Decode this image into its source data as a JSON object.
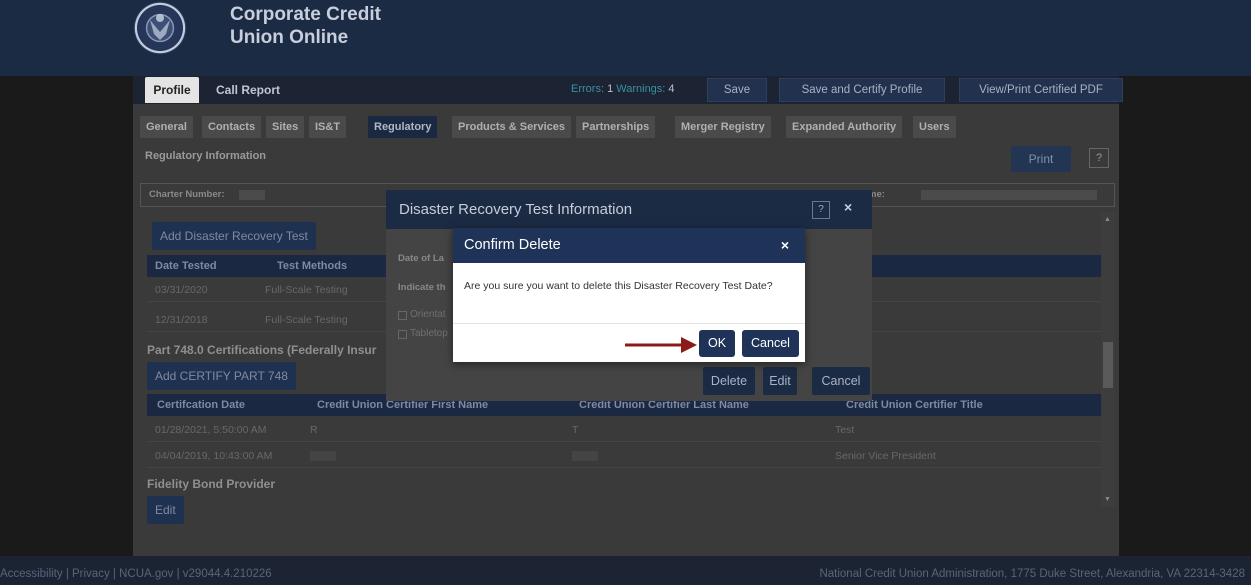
{
  "app": {
    "title": "Corporate Credit Union Online"
  },
  "top_tabs": {
    "profile": "Profile",
    "call_report": "Call Report"
  },
  "status": {
    "errors_label": "Errors:",
    "errors_count": "1",
    "warnings_label": "Warnings:",
    "warnings_count": "4"
  },
  "header_buttons": {
    "save": "Save",
    "save_certify": "Save and Certify Profile",
    "view_print": "View/Print Certified PDF"
  },
  "sub_tabs": [
    "General",
    "Contacts",
    "Sites",
    "IS&T",
    "Regulatory",
    "Products & Services",
    "Partnerships",
    "Merger Registry",
    "Expanded Authority",
    "Users"
  ],
  "active_sub_tab": "Regulatory",
  "section": {
    "title": "Regulatory Information",
    "print": "Print",
    "help": "?"
  },
  "charter_bar": {
    "charter_label": "Charter Number:",
    "name_label": "me:"
  },
  "disaster_recovery": {
    "add_button": "Add Disaster Recovery Test",
    "columns": [
      "Date Tested",
      "Test Methods"
    ],
    "rows": [
      {
        "date": "03/31/2020",
        "method": "Full-Scale Testing"
      },
      {
        "date": "12/31/2018",
        "method": "Full-Scale Testing"
      }
    ]
  },
  "part748": {
    "heading": "Part 748.0 Certifications (Federally Insur",
    "add_button": "Add CERTIFY PART 748",
    "columns": [
      "Certifcation Date",
      "Credit Union Certifier First Name",
      "Credit Union Certifier Last Name",
      "Credit Union Certifier Title"
    ],
    "rows": [
      {
        "date": "01/28/2021, 5:50:00 AM",
        "first": "R",
        "last": "T",
        "title": "Test"
      },
      {
        "date": "04/04/2019, 10:43:00 AM",
        "first": "",
        "last": "",
        "title": "Senior Vice President"
      }
    ]
  },
  "fidelity": {
    "heading": "Fidelity Bond Provider",
    "edit": "Edit"
  },
  "footer": {
    "left": "Accessibility | Privacy | NCUA.gov | v29044.4.210226",
    "right": "National Credit Union Administration, 1775 Duke Street, Alexandria, VA 22314-3428"
  },
  "dr_modal": {
    "title": "Disaster Recovery Test Information",
    "help": "?",
    "close": "×",
    "date_label": "Date of La",
    "indicate_label": "Indicate th",
    "options": [
      "Orientat",
      "Tabletop"
    ],
    "delete": "Delete",
    "edit": "Edit",
    "cancel": "Cancel"
  },
  "confirm_modal": {
    "title": "Confirm Delete",
    "close": "×",
    "message": "Are you sure you want to delete this Disaster Recovery Test Date?",
    "ok": "OK",
    "cancel": "Cancel"
  },
  "colors": {
    "navy": "#1f3358",
    "arrow": "#8b1a1a"
  }
}
